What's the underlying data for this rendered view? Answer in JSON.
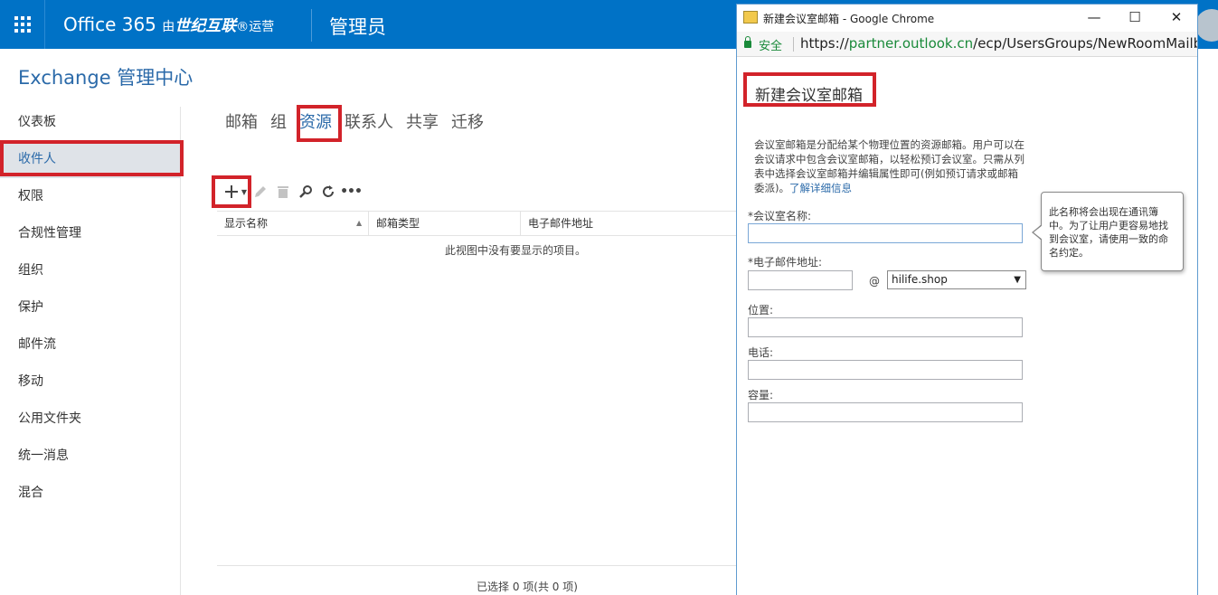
{
  "header": {
    "brand_office": "Office 365",
    "brand_by": "由",
    "brand_partner": "世纪互联",
    "brand_reg": "®",
    "brand_operated": "运营",
    "section_title": "管理员"
  },
  "eac_title": "Exchange 管理中心",
  "sidebar": {
    "items": [
      {
        "label": "仪表板"
      },
      {
        "label": "收件人"
      },
      {
        "label": "权限"
      },
      {
        "label": "合规性管理"
      },
      {
        "label": "组织"
      },
      {
        "label": "保护"
      },
      {
        "label": "邮件流"
      },
      {
        "label": "移动"
      },
      {
        "label": "公用文件夹"
      },
      {
        "label": "统一消息"
      },
      {
        "label": "混合"
      }
    ],
    "active_index": 1
  },
  "tabs": [
    {
      "label": "邮箱"
    },
    {
      "label": "组"
    },
    {
      "label": "资源"
    },
    {
      "label": "联系人"
    },
    {
      "label": "共享"
    },
    {
      "label": "迁移"
    }
  ],
  "toolbar": {
    "add_icon": "plus-icon",
    "edit_icon": "pencil-icon",
    "delete_icon": "trash-icon",
    "search_icon": "search-icon",
    "refresh_icon": "refresh-icon",
    "more_icon": "more-icon"
  },
  "table": {
    "columns": [
      "显示名称",
      "邮箱类型",
      "电子邮件地址"
    ],
    "empty_message": "此视图中没有要显示的项目。",
    "status": "已选择 0 项(共 0 项)"
  },
  "popup": {
    "window_title": "新建会议室邮箱 - Google Chrome",
    "secure_label": "安全",
    "url_scheme": "https://",
    "url_host": "partner.outlook.cn",
    "url_path": "/ecp/UsersGroups/NewRoomMailbox.a",
    "heading": "新建会议室邮箱",
    "description": "会议室邮箱是分配给某个物理位置的资源邮箱。用户可以在会议请求中包含会议室邮箱，以轻松预订会议室。只需从列表中选择会议室邮箱并编辑属性即可(例如预订请求或邮箱委派)。",
    "learn_more": "了解详细信息",
    "fields": {
      "room_name_label": "*会议室名称:",
      "room_name_value": "",
      "email_label": "*电子邮件地址:",
      "email_value": "",
      "at_sign": "@",
      "domain_selected": "hilife.shop",
      "location_label": "位置:",
      "location_value": "",
      "phone_label": "电话:",
      "phone_value": "",
      "capacity_label": "容量:",
      "capacity_value": ""
    },
    "tooltip": "此名称将会出现在通讯簿中。为了让用户更容易地找到会议室，请使用一致的命名约定。"
  },
  "colors": {
    "header_bg": "#0072c6",
    "accent": "#2b6aa9",
    "highlight_box": "#d2232a",
    "secure_green": "#1a8a3a"
  }
}
